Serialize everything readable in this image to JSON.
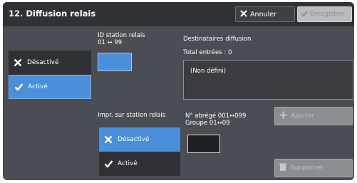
{
  "header": {
    "title": "12. Diffusion relais",
    "cancel_label": "Annuler",
    "save_label": "Enregistrer"
  },
  "relay_mode": {
    "options": [
      {
        "label": "Désactivé",
        "selected": false
      },
      {
        "label": "Activé",
        "selected": true
      }
    ]
  },
  "station_id": {
    "label": "ID station relais",
    "range": "01 ↔ 99",
    "value": ""
  },
  "recipients": {
    "title": "Destinataires diffusion",
    "total": "Total entrées : 0",
    "content": "(Non défini)"
  },
  "print_at_station": {
    "label": "Impr. sur station relais",
    "options": [
      {
        "label": "Désactivé",
        "selected": true
      },
      {
        "label": "Activé",
        "selected": false
      }
    ]
  },
  "speed_dial": {
    "label_line1": "N° abrégé 001↔099",
    "label_line2": "Groupe 01↔09",
    "value": ""
  },
  "actions": {
    "add_label": "Ajouter",
    "delete_label": "Supprimer"
  },
  "colors": {
    "accent": "#4b8ed9",
    "panel": "#4a4d53",
    "header": "#2f3136"
  }
}
